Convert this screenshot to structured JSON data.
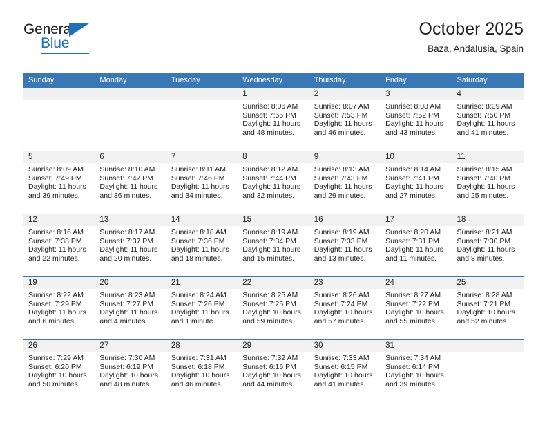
{
  "brand": {
    "name_top": "General",
    "name_bottom": "Blue",
    "accent_color": "#1f72b8",
    "triangle_icon": "triangle-icon"
  },
  "header": {
    "title": "October 2025",
    "location": "Baza, Andalusia, Spain"
  },
  "calendar": {
    "header_background": "#3a77b5",
    "daynum_background": "#f1f1f1",
    "weekday_headers": [
      "Sunday",
      "Monday",
      "Tuesday",
      "Wednesday",
      "Thursday",
      "Friday",
      "Saturday"
    ],
    "weeks": [
      [
        {
          "day": "",
          "sunrise": "",
          "sunset": "",
          "daylight1": "",
          "daylight2": ""
        },
        {
          "day": "",
          "sunrise": "",
          "sunset": "",
          "daylight1": "",
          "daylight2": ""
        },
        {
          "day": "",
          "sunrise": "",
          "sunset": "",
          "daylight1": "",
          "daylight2": ""
        },
        {
          "day": "1",
          "sunrise": "Sunrise: 8:06 AM",
          "sunset": "Sunset: 7:55 PM",
          "daylight1": "Daylight: 11 hours",
          "daylight2": "and 48 minutes."
        },
        {
          "day": "2",
          "sunrise": "Sunrise: 8:07 AM",
          "sunset": "Sunset: 7:53 PM",
          "daylight1": "Daylight: 11 hours",
          "daylight2": "and 46 minutes."
        },
        {
          "day": "3",
          "sunrise": "Sunrise: 8:08 AM",
          "sunset": "Sunset: 7:52 PM",
          "daylight1": "Daylight: 11 hours",
          "daylight2": "and 43 minutes."
        },
        {
          "day": "4",
          "sunrise": "Sunrise: 8:09 AM",
          "sunset": "Sunset: 7:50 PM",
          "daylight1": "Daylight: 11 hours",
          "daylight2": "and 41 minutes."
        }
      ],
      [
        {
          "day": "5",
          "sunrise": "Sunrise: 8:09 AM",
          "sunset": "Sunset: 7:49 PM",
          "daylight1": "Daylight: 11 hours",
          "daylight2": "and 39 minutes."
        },
        {
          "day": "6",
          "sunrise": "Sunrise: 8:10 AM",
          "sunset": "Sunset: 7:47 PM",
          "daylight1": "Daylight: 11 hours",
          "daylight2": "and 36 minutes."
        },
        {
          "day": "7",
          "sunrise": "Sunrise: 8:11 AM",
          "sunset": "Sunset: 7:46 PM",
          "daylight1": "Daylight: 11 hours",
          "daylight2": "and 34 minutes."
        },
        {
          "day": "8",
          "sunrise": "Sunrise: 8:12 AM",
          "sunset": "Sunset: 7:44 PM",
          "daylight1": "Daylight: 11 hours",
          "daylight2": "and 32 minutes."
        },
        {
          "day": "9",
          "sunrise": "Sunrise: 8:13 AM",
          "sunset": "Sunset: 7:43 PM",
          "daylight1": "Daylight: 11 hours",
          "daylight2": "and 29 minutes."
        },
        {
          "day": "10",
          "sunrise": "Sunrise: 8:14 AM",
          "sunset": "Sunset: 7:41 PM",
          "daylight1": "Daylight: 11 hours",
          "daylight2": "and 27 minutes."
        },
        {
          "day": "11",
          "sunrise": "Sunrise: 8:15 AM",
          "sunset": "Sunset: 7:40 PM",
          "daylight1": "Daylight: 11 hours",
          "daylight2": "and 25 minutes."
        }
      ],
      [
        {
          "day": "12",
          "sunrise": "Sunrise: 8:16 AM",
          "sunset": "Sunset: 7:38 PM",
          "daylight1": "Daylight: 11 hours",
          "daylight2": "and 22 minutes."
        },
        {
          "day": "13",
          "sunrise": "Sunrise: 8:17 AM",
          "sunset": "Sunset: 7:37 PM",
          "daylight1": "Daylight: 11 hours",
          "daylight2": "and 20 minutes."
        },
        {
          "day": "14",
          "sunrise": "Sunrise: 8:18 AM",
          "sunset": "Sunset: 7:36 PM",
          "daylight1": "Daylight: 11 hours",
          "daylight2": "and 18 minutes."
        },
        {
          "day": "15",
          "sunrise": "Sunrise: 8:19 AM",
          "sunset": "Sunset: 7:34 PM",
          "daylight1": "Daylight: 11 hours",
          "daylight2": "and 15 minutes."
        },
        {
          "day": "16",
          "sunrise": "Sunrise: 8:19 AM",
          "sunset": "Sunset: 7:33 PM",
          "daylight1": "Daylight: 11 hours",
          "daylight2": "and 13 minutes."
        },
        {
          "day": "17",
          "sunrise": "Sunrise: 8:20 AM",
          "sunset": "Sunset: 7:31 PM",
          "daylight1": "Daylight: 11 hours",
          "daylight2": "and 11 minutes."
        },
        {
          "day": "18",
          "sunrise": "Sunrise: 8:21 AM",
          "sunset": "Sunset: 7:30 PM",
          "daylight1": "Daylight: 11 hours",
          "daylight2": "and 8 minutes."
        }
      ],
      [
        {
          "day": "19",
          "sunrise": "Sunrise: 8:22 AM",
          "sunset": "Sunset: 7:29 PM",
          "daylight1": "Daylight: 11 hours",
          "daylight2": "and 6 minutes."
        },
        {
          "day": "20",
          "sunrise": "Sunrise: 8:23 AM",
          "sunset": "Sunset: 7:27 PM",
          "daylight1": "Daylight: 11 hours",
          "daylight2": "and 4 minutes."
        },
        {
          "day": "21",
          "sunrise": "Sunrise: 8:24 AM",
          "sunset": "Sunset: 7:26 PM",
          "daylight1": "Daylight: 11 hours",
          "daylight2": "and 1 minute."
        },
        {
          "day": "22",
          "sunrise": "Sunrise: 8:25 AM",
          "sunset": "Sunset: 7:25 PM",
          "daylight1": "Daylight: 10 hours",
          "daylight2": "and 59 minutes."
        },
        {
          "day": "23",
          "sunrise": "Sunrise: 8:26 AM",
          "sunset": "Sunset: 7:24 PM",
          "daylight1": "Daylight: 10 hours",
          "daylight2": "and 57 minutes."
        },
        {
          "day": "24",
          "sunrise": "Sunrise: 8:27 AM",
          "sunset": "Sunset: 7:22 PM",
          "daylight1": "Daylight: 10 hours",
          "daylight2": "and 55 minutes."
        },
        {
          "day": "25",
          "sunrise": "Sunrise: 8:28 AM",
          "sunset": "Sunset: 7:21 PM",
          "daylight1": "Daylight: 10 hours",
          "daylight2": "and 52 minutes."
        }
      ],
      [
        {
          "day": "26",
          "sunrise": "Sunrise: 7:29 AM",
          "sunset": "Sunset: 6:20 PM",
          "daylight1": "Daylight: 10 hours",
          "daylight2": "and 50 minutes."
        },
        {
          "day": "27",
          "sunrise": "Sunrise: 7:30 AM",
          "sunset": "Sunset: 6:19 PM",
          "daylight1": "Daylight: 10 hours",
          "daylight2": "and 48 minutes."
        },
        {
          "day": "28",
          "sunrise": "Sunrise: 7:31 AM",
          "sunset": "Sunset: 6:18 PM",
          "daylight1": "Daylight: 10 hours",
          "daylight2": "and 46 minutes."
        },
        {
          "day": "29",
          "sunrise": "Sunrise: 7:32 AM",
          "sunset": "Sunset: 6:16 PM",
          "daylight1": "Daylight: 10 hours",
          "daylight2": "and 44 minutes."
        },
        {
          "day": "30",
          "sunrise": "Sunrise: 7:33 AM",
          "sunset": "Sunset: 6:15 PM",
          "daylight1": "Daylight: 10 hours",
          "daylight2": "and 41 minutes."
        },
        {
          "day": "31",
          "sunrise": "Sunrise: 7:34 AM",
          "sunset": "Sunset: 6:14 PM",
          "daylight1": "Daylight: 10 hours",
          "daylight2": "and 39 minutes."
        },
        {
          "day": "",
          "sunrise": "",
          "sunset": "",
          "daylight1": "",
          "daylight2": ""
        }
      ]
    ]
  }
}
